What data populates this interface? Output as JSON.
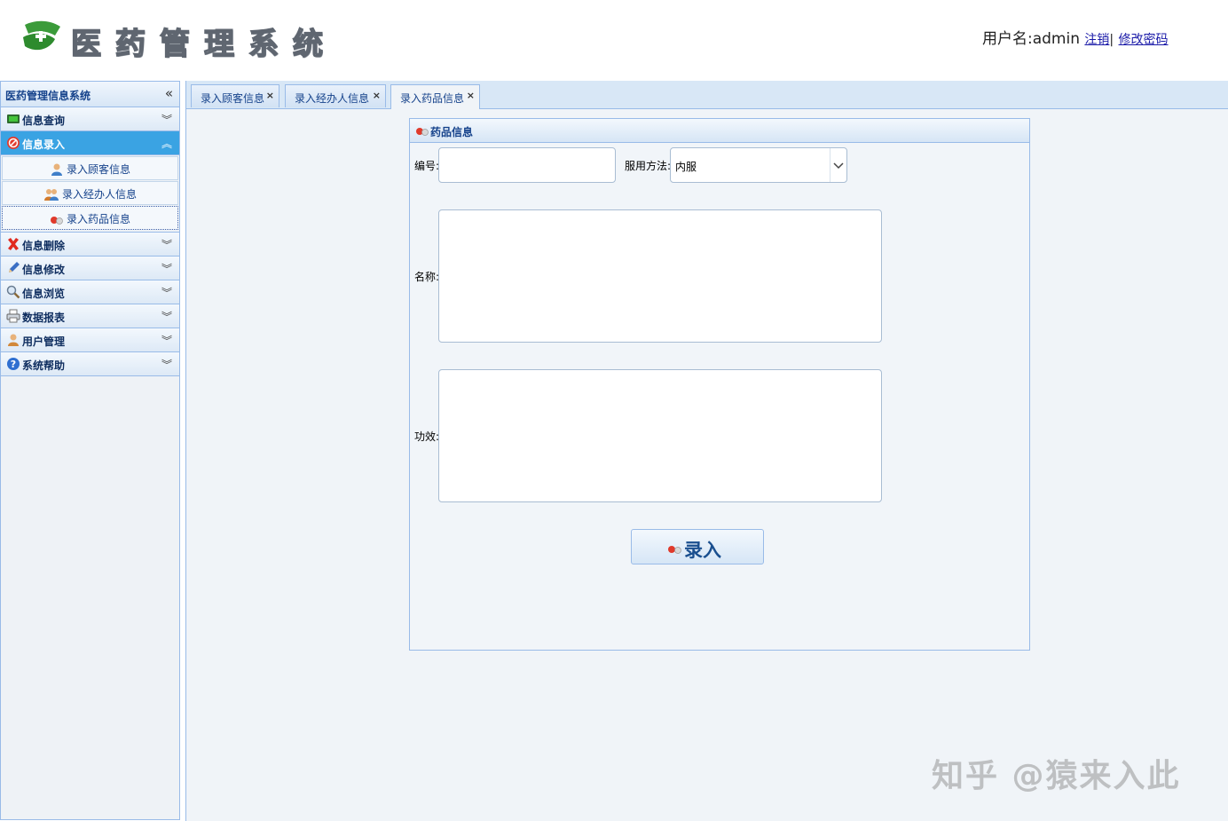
{
  "header": {
    "app_title": "医药管理系统",
    "user_label": "用户名:admin",
    "logout_link": "注销",
    "separator": "|",
    "change_password_link": "修改密码"
  },
  "sidebar": {
    "title": "医药管理信息系统",
    "collapse_icon": "«",
    "sections": [
      {
        "label": "信息查询",
        "icon": "monitor-icon"
      },
      {
        "label": "信息录入",
        "icon": "stop-icon",
        "expanded": true
      },
      {
        "label": "信息删除",
        "icon": "cross-icon"
      },
      {
        "label": "信息修改",
        "icon": "pencil-icon"
      },
      {
        "label": "信息浏览",
        "icon": "magnifier-icon"
      },
      {
        "label": "数据报表",
        "icon": "printer-icon"
      },
      {
        "label": "用户管理",
        "icon": "user-icon"
      },
      {
        "label": "系统帮助",
        "icon": "help-icon"
      }
    ],
    "sub_items": [
      {
        "label": "录入顾客信息",
        "icon": "customer-icon"
      },
      {
        "label": "录入经办人信息",
        "icon": "group-icon"
      },
      {
        "label": "录入药品信息",
        "icon": "pill-icon",
        "selected": true
      }
    ]
  },
  "tabs": [
    {
      "label": "录入顾客信息",
      "close": "×"
    },
    {
      "label": "录入经办人信息",
      "close": "×"
    },
    {
      "label": "录入药品信息",
      "close": "×",
      "active": true
    }
  ],
  "form": {
    "panel_title": "药品信息",
    "id_label": "编号:",
    "id_value": "",
    "usage_label": "服用方法:",
    "usage_value": "内服",
    "name_label": "名称:",
    "name_value": "",
    "effect_label": "功效:",
    "effect_value": "",
    "submit_label": "录入"
  },
  "watermark": "知乎 @猿来入此",
  "colors": {
    "accent": "#3aa3e3",
    "border": "#99bbe8",
    "header_text": "#15428b"
  }
}
